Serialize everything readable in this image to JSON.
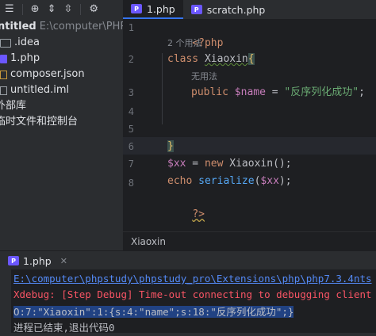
{
  "toolbar": {
    "icons": [
      "list-icon",
      "target-icon",
      "collapse-icon",
      "expand-icon",
      "gear-icon"
    ]
  },
  "tabs": [
    {
      "label": "1.php",
      "active": true
    },
    {
      "label": "scratch.php",
      "active": false
    }
  ],
  "sidebar": {
    "project_name": "ntitled",
    "project_path": "E:\\computer\\PHP\\ui",
    "items": [
      {
        "label": ".idea",
        "type": "folder"
      },
      {
        "label": "1.php",
        "type": "php"
      },
      {
        "label": "composer.json",
        "type": "json"
      },
      {
        "label": "untitled.iml",
        "type": "iml"
      }
    ],
    "external_libraries": "外部库",
    "scratches": "临时文件和控制台"
  },
  "editor": {
    "line_numbers": [
      "1",
      "2",
      "3",
      "4",
      "5",
      "6",
      "7",
      "8"
    ],
    "hint_usages": "2 个用法",
    "hint_unused": "无用法",
    "line1": "<?php",
    "line2_kw": "class",
    "line2_name": "Xiaoxin",
    "line2_brace": "{",
    "line3_kw": "public",
    "line3_var": "$name",
    "line3_eq": " = ",
    "line3_str": "\"反序列化成功\"",
    "line3_end": ";",
    "line5_brace": "}",
    "line6_var": "$xx",
    "line6_mid": " = ",
    "line6_kw": "new",
    "line6_rest": " Xiaoxin();",
    "line7_kw": "echo",
    "line7_fn": "serialize",
    "line7_open": "(",
    "line7_var": "$xx",
    "line7_close": ");",
    "line8": "?>"
  },
  "breadcrumb": "Xiaoxin",
  "run": {
    "tab_label": "1.php",
    "console": {
      "path": "E:\\computer\\phpstudy\\phpstudy_pro\\Extensions\\php\\php7.3.4nts",
      "xdebug": "Xdebug: [Step Debug] Time-out connecting to debugging client",
      "output": "O:7:\"Xiaoxin\":1:{s:4:\"name\";s:18:\"反序列化成功\";}",
      "exit": "进程已结束,退出代码0"
    }
  },
  "colors": {
    "accent": "#3574f0",
    "keyword": "#cf8e6d",
    "variable": "#c77dbb",
    "string": "#6aab73",
    "function": "#56a8f5",
    "error": "#f75464",
    "link": "#548af7"
  }
}
